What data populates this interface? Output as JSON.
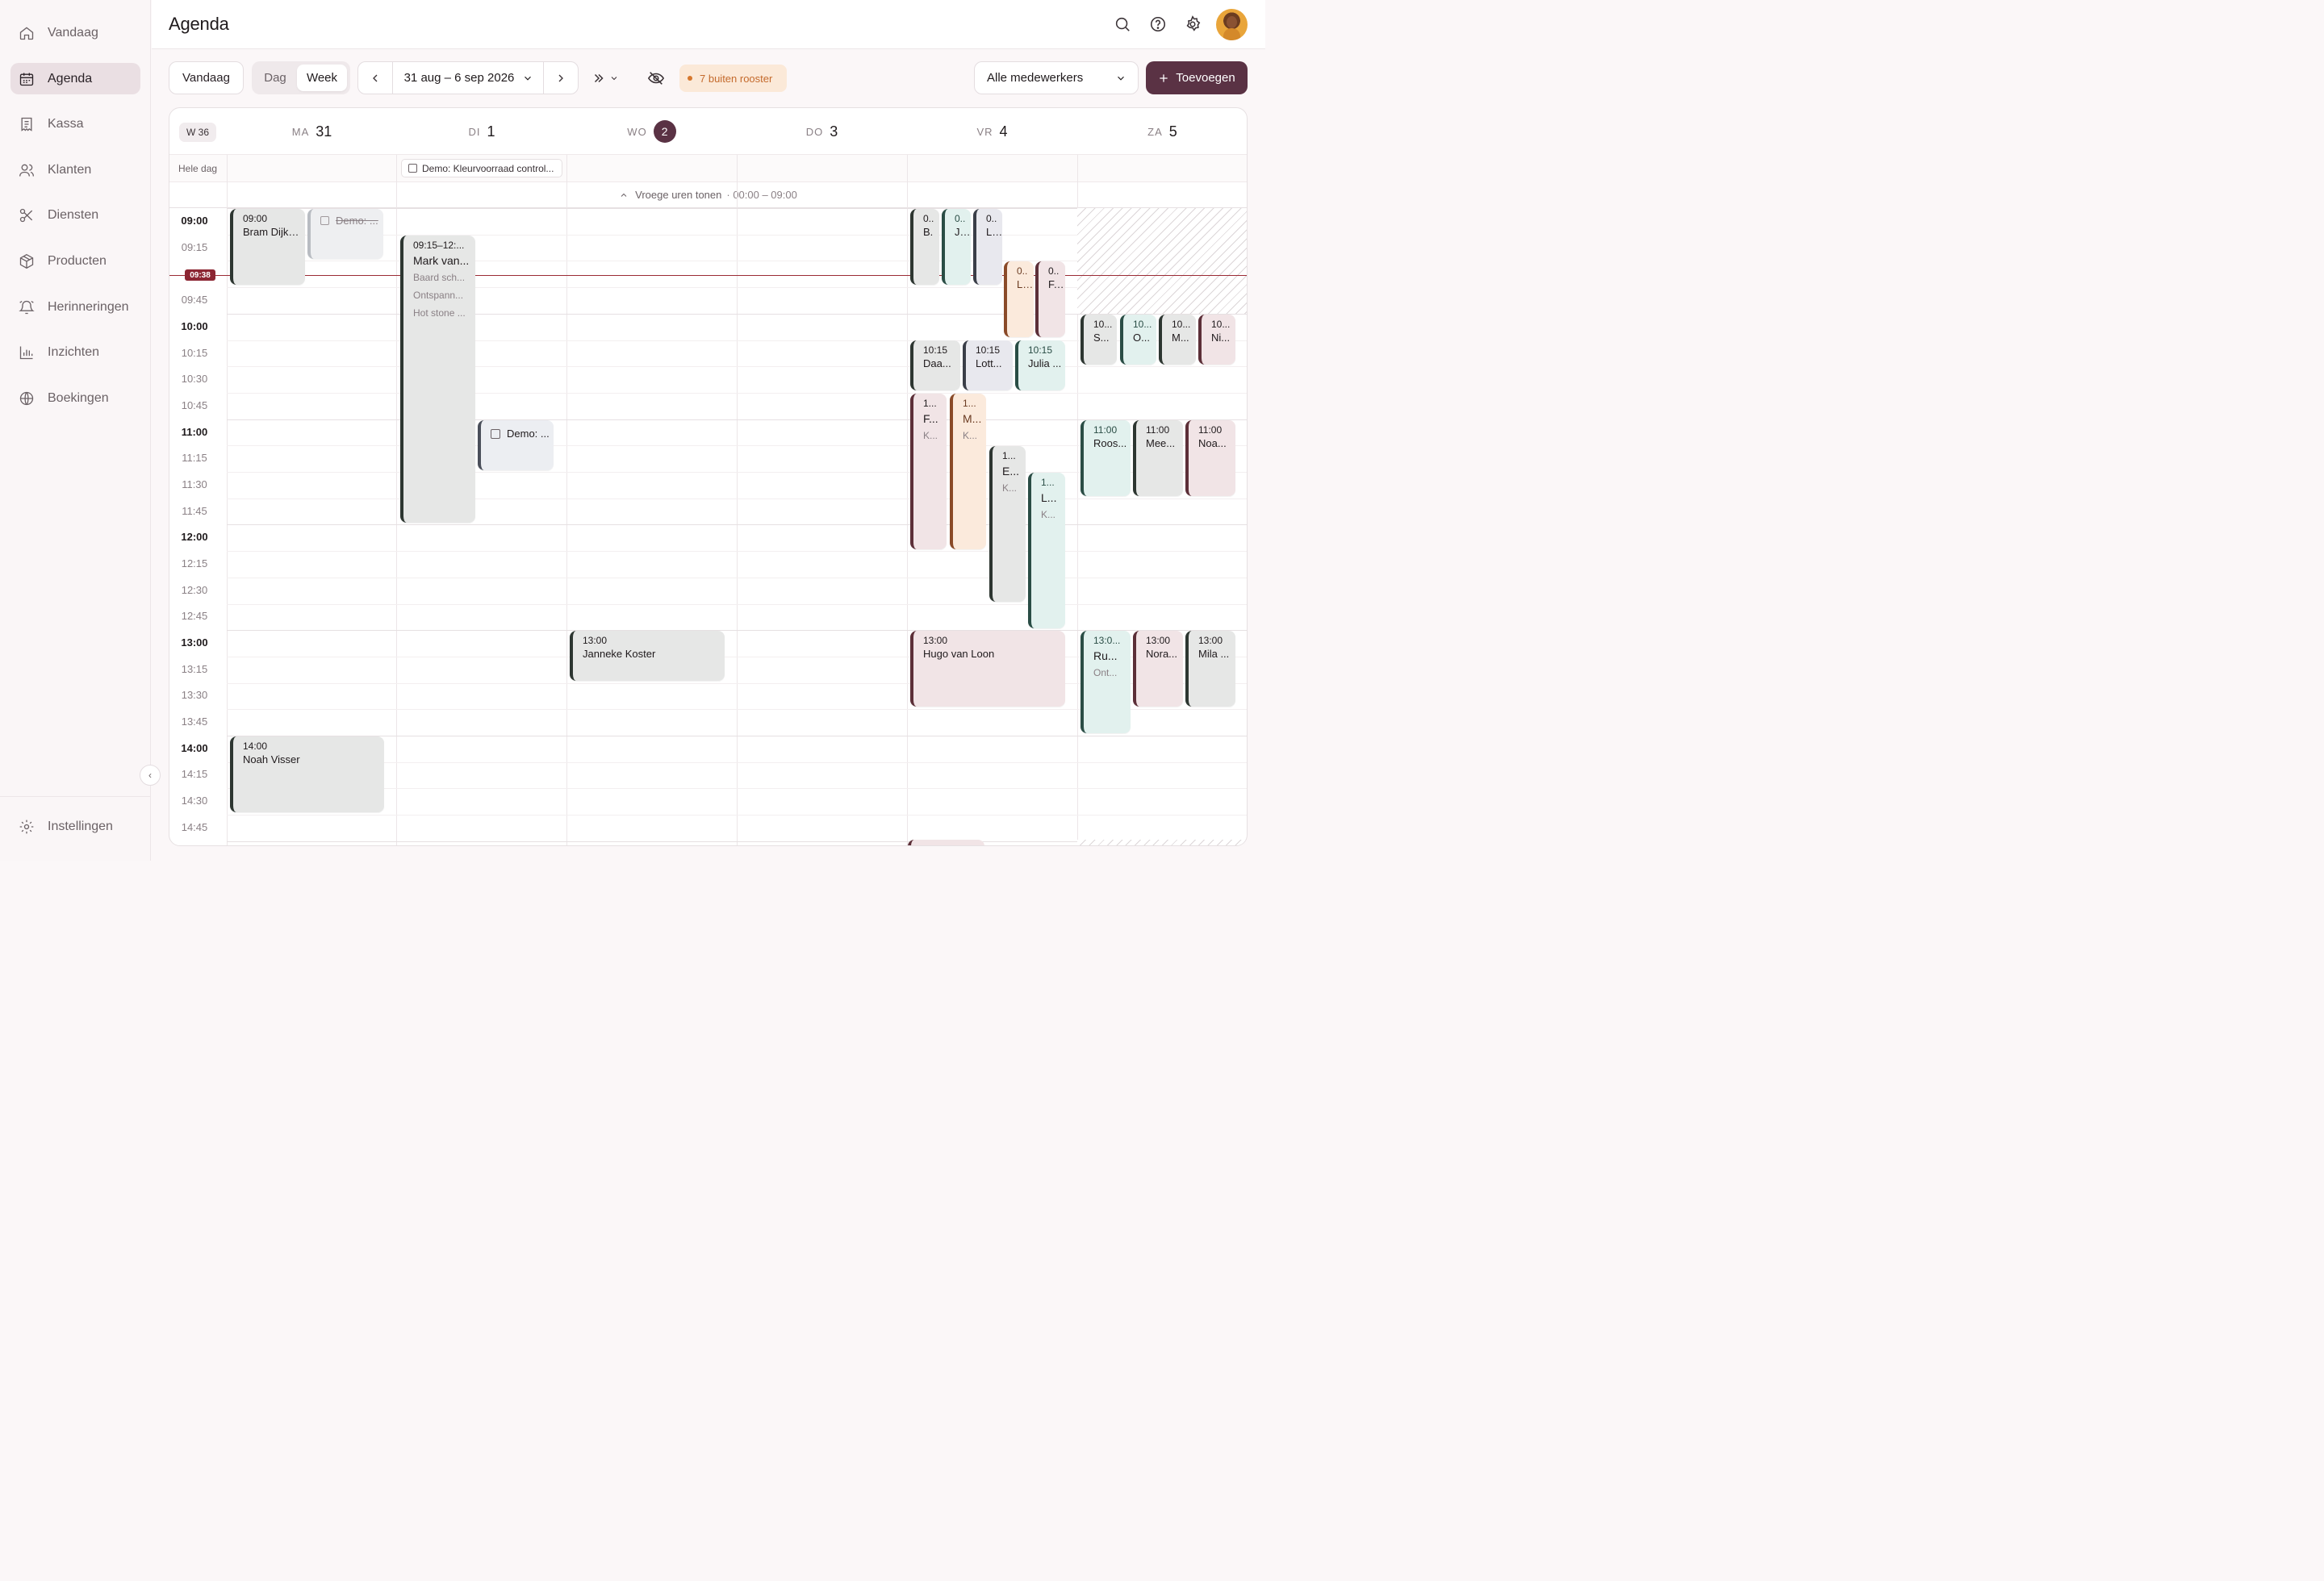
{
  "sidebar": {
    "items": [
      {
        "label": "Vandaag"
      },
      {
        "label": "Agenda"
      },
      {
        "label": "Kassa"
      },
      {
        "label": "Klanten"
      },
      {
        "label": "Diensten"
      },
      {
        "label": "Producten"
      },
      {
        "label": "Herinneringen"
      },
      {
        "label": "Inzichten"
      },
      {
        "label": "Boekingen"
      }
    ],
    "settings_label": "Instellingen",
    "active": "Agenda"
  },
  "header": {
    "title": "Agenda"
  },
  "toolbar": {
    "today_label": "Vandaag",
    "view_day": "Dag",
    "view_week": "Week",
    "date_range": "31 aug – 6 sep 2026",
    "outside_schedule_badge": "7 buiten rooster",
    "staff_select": "Alle medewerkers",
    "add_label": "Toevoegen"
  },
  "calendar": {
    "week_badge": "W 36",
    "days": [
      {
        "name": "MA",
        "num": "31"
      },
      {
        "name": "DI",
        "num": "1"
      },
      {
        "name": "WO",
        "num": "2"
      },
      {
        "name": "DO",
        "num": "3"
      },
      {
        "name": "VR",
        "num": "4"
      },
      {
        "name": "ZA",
        "num": "5"
      }
    ],
    "today_index": 2,
    "allday_label": "Hele dag",
    "allday_event": "Demo: Kleurvoorraad control...",
    "early_hours": "Vroege uren tonen",
    "early_hours_range": "· 00:00 – 09:00",
    "now_time": "09:38",
    "time_labels": [
      "09:00",
      "09:15",
      "09:30",
      "09:45",
      "10:00",
      "10:15",
      "10:30",
      "10:45",
      "11:00",
      "11:15",
      "11:30",
      "11:45",
      "12:00",
      "12:15",
      "12:30",
      "12:45",
      "13:00",
      "13:15",
      "13:30",
      "13:45",
      "14:00",
      "14:15",
      "14:30",
      "14:45"
    ]
  },
  "events": [
    {
      "day": 0,
      "time": "09:00",
      "name": "Bram Dijks...",
      "color": "gray"
    },
    {
      "day": 0,
      "time": "",
      "name": "Demo: ...",
      "color": "ghost"
    },
    {
      "day": 0,
      "time": "14:00",
      "name": "Noah Visser",
      "color": "gray"
    },
    {
      "day": 1,
      "time": "09:15–12:...",
      "name": "Mark van...",
      "services": [
        "Baard sch...",
        "Ontspann...",
        "Hot stone ..."
      ],
      "color": "gray"
    },
    {
      "day": 1,
      "time": "",
      "name": "Demo: ...",
      "color": "task"
    },
    {
      "day": 2,
      "time": "13:00",
      "name": "Janneke Koster",
      "color": "gray"
    },
    {
      "day": 4,
      "time": "0..",
      "name": "B.",
      "color": "gray"
    },
    {
      "day": 4,
      "time": "0..",
      "name": "J...",
      "color": "mint"
    },
    {
      "day": 4,
      "time": "0..",
      "name": "L...",
      "color": "slate"
    },
    {
      "day": 4,
      "time": "0..",
      "name": "L...",
      "color": "peach"
    },
    {
      "day": 4,
      "time": "0..",
      "name": "F...",
      "color": "pink"
    },
    {
      "day": 4,
      "time": "10:15",
      "name": "Daa...",
      "color": "gray"
    },
    {
      "day": 4,
      "time": "10:15",
      "name": "Lott...",
      "color": "slate"
    },
    {
      "day": 4,
      "time": "10:15",
      "name": "Julia ...",
      "color": "mint"
    },
    {
      "day": 4,
      "time": "1...",
      "name": "F...",
      "sub": "K...",
      "color": "pink"
    },
    {
      "day": 4,
      "time": "1...",
      "name": "M...",
      "sub": "K...",
      "color": "peach"
    },
    {
      "day": 4,
      "time": "1...",
      "name": "E...",
      "sub": "K...",
      "color": "gray"
    },
    {
      "day": 4,
      "time": "1...",
      "name": "L...",
      "sub": "K...",
      "color": "mint"
    },
    {
      "day": 4,
      "time": "13:00",
      "name": "Hugo van Loon",
      "color": "pink"
    },
    {
      "day": 5,
      "time": "10...",
      "name": "S...",
      "color": "gray"
    },
    {
      "day": 5,
      "time": "10...",
      "name": "O...",
      "color": "mint"
    },
    {
      "day": 5,
      "time": "10...",
      "name": "M...",
      "color": "gray"
    },
    {
      "day": 5,
      "time": "10...",
      "name": "Ni...",
      "color": "pink"
    },
    {
      "day": 5,
      "time": "11:00",
      "name": "Roos...",
      "color": "mint"
    },
    {
      "day": 5,
      "time": "11:00",
      "name": "Mee...",
      "color": "gray"
    },
    {
      "day": 5,
      "time": "11:00",
      "name": "Noa...",
      "color": "pink"
    },
    {
      "day": 5,
      "time": "13:0...",
      "name": "Ru...",
      "sub": "Ont...",
      "color": "mint"
    },
    {
      "day": 5,
      "time": "13:00",
      "name": "Nora...",
      "color": "pink"
    },
    {
      "day": 5,
      "time": "13:00",
      "name": "Mila ...",
      "color": "gray"
    }
  ],
  "colors": {
    "accent": "#5a3244",
    "now_line": "#9b2b35",
    "badge_bg": "#fbe9d8",
    "badge_text": "#c46a2c"
  }
}
